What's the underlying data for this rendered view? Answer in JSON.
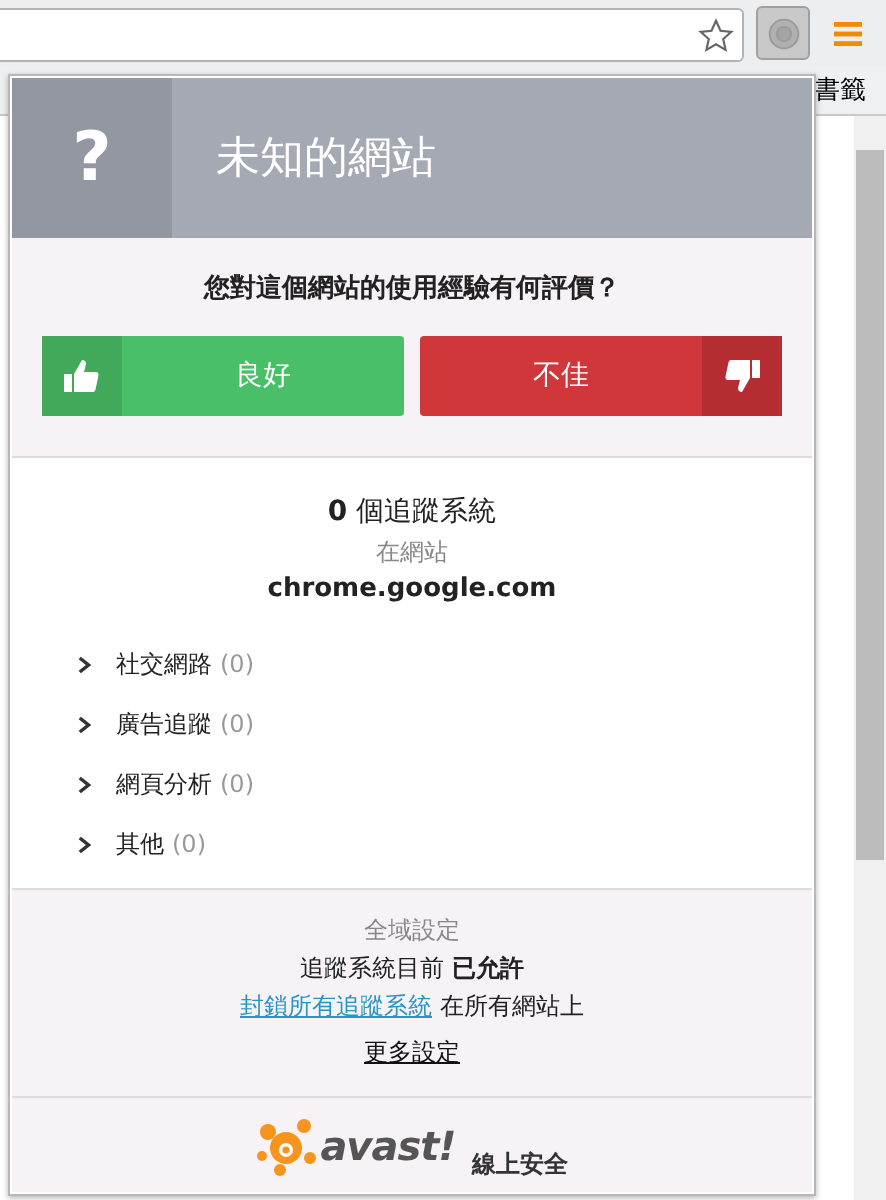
{
  "browser": {
    "bookmarks_text": "書籤"
  },
  "popup": {
    "header": {
      "icon": "?",
      "title": "未知的網站"
    },
    "rating": {
      "question": "您對這個網站的使用經驗有何評價？",
      "buttons": [
        {
          "kind": "good",
          "label": "良好"
        },
        {
          "kind": "bad",
          "label": "不佳"
        }
      ]
    },
    "trackers": {
      "count_line": "**0** 個追蹤系統",
      "site_label": "在網站",
      "domain": "chrome.google.com",
      "categories": [
        {
          "label": "社交網路",
          "count": "(0)",
          "expanded": false
        },
        {
          "label": "廣告追蹤",
          "count": "(0)",
          "expanded": false
        },
        {
          "label": "網頁分析",
          "count": "(0)",
          "expanded": false
        },
        {
          "label": "其他",
          "count": "(0)",
          "expanded": false
        }
      ]
    },
    "global": {
      "title": "全域設定",
      "status": "追蹤系統目前 **已允許**",
      "block_link": "封鎖所有追蹤系統",
      "block_suffix": "在所有網站上",
      "more_settings": "更多設定"
    },
    "footer": {
      "logo": "avast!",
      "tagline": "線上安全"
    }
  }
}
